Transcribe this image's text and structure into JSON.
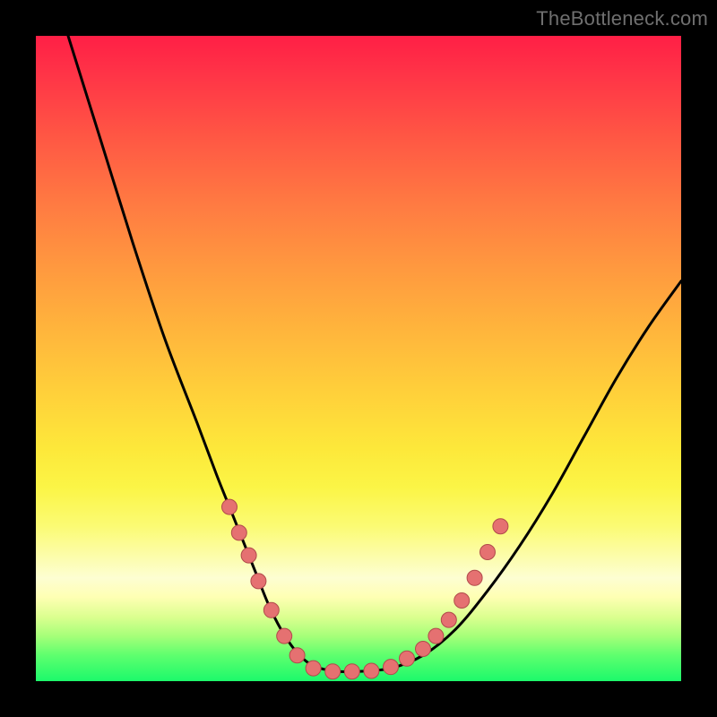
{
  "watermark": "TheBottleneck.com",
  "colors": {
    "frame": "#000000",
    "curve_stroke": "#000000",
    "marker_fill": "#e57171",
    "marker_stroke": "#b14b4b",
    "watermark_text": "#6f6f6f"
  },
  "chart_data": {
    "type": "line",
    "title": "",
    "xlabel": "",
    "ylabel": "",
    "xlim": [
      0,
      100
    ],
    "ylim": [
      0,
      100
    ],
    "grid": false,
    "legend": false,
    "note": "No axis ticks or numeric labels are visible; values are pixel-relative estimates in 0–100 coordinate space (origin bottom-left).",
    "series": [
      {
        "name": "main-curve",
        "x": [
          5,
          10,
          15,
          20,
          25,
          28,
          30,
          32,
          34,
          36,
          38,
          40,
          42,
          44,
          47,
          50,
          55,
          60,
          65,
          70,
          75,
          80,
          85,
          90,
          95,
          100
        ],
        "y": [
          100,
          84,
          68,
          53,
          40,
          32,
          27,
          22,
          17,
          12,
          8,
          5,
          3,
          2,
          1.5,
          1.5,
          2,
          4,
          8,
          14,
          21,
          29,
          38,
          47,
          55,
          62
        ]
      }
    ],
    "markers": [
      {
        "x": 30.0,
        "y": 27.0
      },
      {
        "x": 31.5,
        "y": 23.0
      },
      {
        "x": 33.0,
        "y": 19.5
      },
      {
        "x": 34.5,
        "y": 15.5
      },
      {
        "x": 36.5,
        "y": 11.0
      },
      {
        "x": 38.5,
        "y": 7.0
      },
      {
        "x": 40.5,
        "y": 4.0
      },
      {
        "x": 43.0,
        "y": 2.0
      },
      {
        "x": 46.0,
        "y": 1.5
      },
      {
        "x": 49.0,
        "y": 1.5
      },
      {
        "x": 52.0,
        "y": 1.6
      },
      {
        "x": 55.0,
        "y": 2.2
      },
      {
        "x": 57.5,
        "y": 3.5
      },
      {
        "x": 60.0,
        "y": 5.0
      },
      {
        "x": 62.0,
        "y": 7.0
      },
      {
        "x": 64.0,
        "y": 9.5
      },
      {
        "x": 66.0,
        "y": 12.5
      },
      {
        "x": 68.0,
        "y": 16.0
      },
      {
        "x": 70.0,
        "y": 20.0
      },
      {
        "x": 72.0,
        "y": 24.0
      }
    ],
    "background_gradient": {
      "direction": "vertical_top_to_bottom",
      "stops": [
        {
          "pos": 0.0,
          "color": "#ff1f46"
        },
        {
          "pos": 0.5,
          "color": "#ffcc3b"
        },
        {
          "pos": 0.8,
          "color": "#fdfd90"
        },
        {
          "pos": 1.0,
          "color": "#1cf96b"
        }
      ]
    }
  }
}
